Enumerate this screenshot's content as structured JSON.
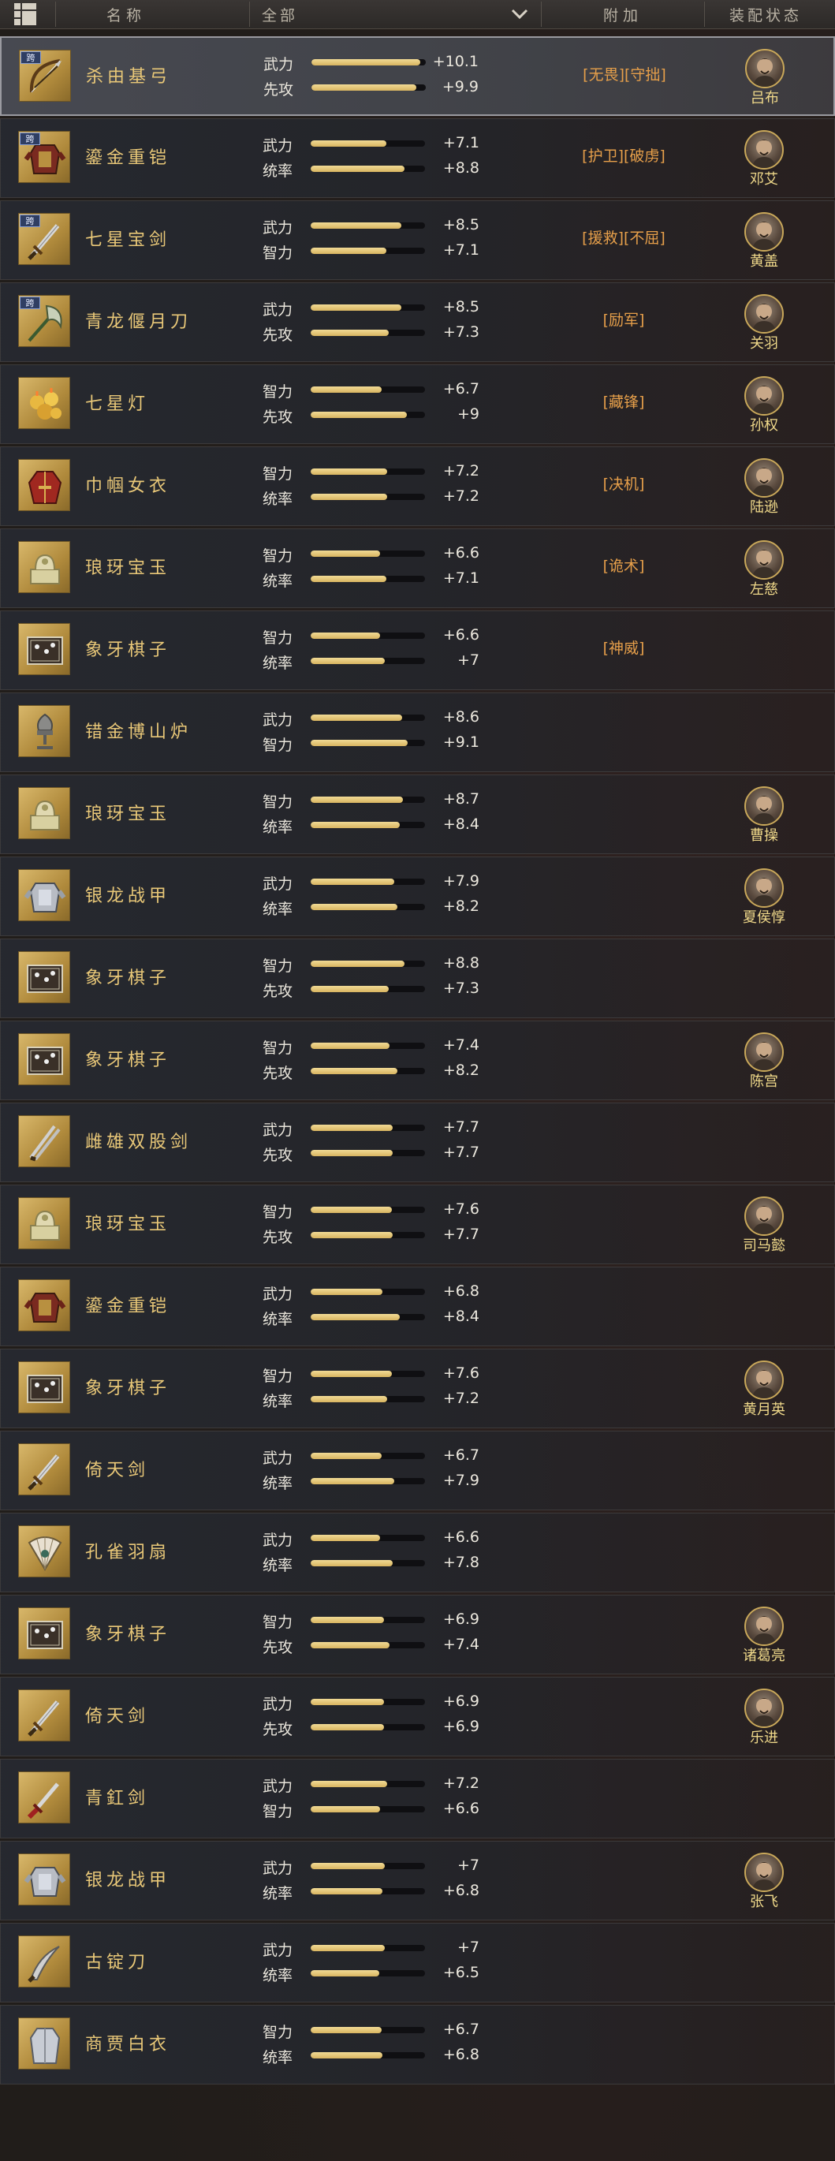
{
  "header": {
    "name_label": "名称",
    "filter_label": "全部",
    "bonus_label": "附加",
    "equip_label": "装配状态"
  },
  "items": [
    {
      "name": "杀由基弓",
      "kua": "跨",
      "icon": "bow-icon",
      "s1": "武力",
      "v1": "+10.1",
      "f1": 0.95,
      "s2": "先攻",
      "v2": "+9.9",
      "f2": 0.92,
      "tags": "[无畏][守拙]",
      "hero": "吕布",
      "selected": true
    },
    {
      "name": "鎏金重铠",
      "kua": "跨",
      "icon": "armor-icon",
      "s1": "武力",
      "v1": "+7.1",
      "f1": 0.66,
      "s2": "统率",
      "v2": "+8.8",
      "f2": 0.82,
      "tags": "[护卫][破虏]",
      "hero": "邓艾"
    },
    {
      "name": "七星宝剑",
      "kua": "跨",
      "icon": "sword-icon",
      "s1": "武力",
      "v1": "+8.5",
      "f1": 0.79,
      "s2": "智力",
      "v2": "+7.1",
      "f2": 0.66,
      "tags": "[援救][不屈]",
      "hero": "黄盖"
    },
    {
      "name": "青龙偃月刀",
      "kua": "跨",
      "icon": "glaive-icon",
      "s1": "武力",
      "v1": "+8.5",
      "f1": 0.79,
      "s2": "先攻",
      "v2": "+7.3",
      "f2": 0.68,
      "tags": "[励军]",
      "hero": "关羽"
    },
    {
      "name": "七星灯",
      "icon": "lamp-icon",
      "s1": "智力",
      "v1": "+6.7",
      "f1": 0.62,
      "s2": "先攻",
      "v2": "+9",
      "f2": 0.84,
      "tags": "[藏锋]",
      "hero": "孙权"
    },
    {
      "name": "巾帼女衣",
      "icon": "robe-icon",
      "s1": "智力",
      "v1": "+7.2",
      "f1": 0.67,
      "s2": "统率",
      "v2": "+7.2",
      "f2": 0.67,
      "tags": "[决机]",
      "hero": "陆逊"
    },
    {
      "name": "琅玡宝玉",
      "icon": "jade-seal-icon",
      "s1": "智力",
      "v1": "+6.6",
      "f1": 0.61,
      "s2": "统率",
      "v2": "+7.1",
      "f2": 0.66,
      "tags": "[诡术]",
      "hero": "左慈"
    },
    {
      "name": "象牙棋子",
      "icon": "chess-icon",
      "s1": "智力",
      "v1": "+6.6",
      "f1": 0.61,
      "s2": "统率",
      "v2": "+7",
      "f2": 0.65,
      "tags": "[神威]",
      "hero": ""
    },
    {
      "name": "错金博山炉",
      "icon": "censer-icon",
      "s1": "武力",
      "v1": "+8.6",
      "f1": 0.8,
      "s2": "智力",
      "v2": "+9.1",
      "f2": 0.85,
      "tags": "",
      "hero": ""
    },
    {
      "name": "琅玡宝玉",
      "icon": "jade-seal-icon",
      "s1": "智力",
      "v1": "+8.7",
      "f1": 0.81,
      "s2": "统率",
      "v2": "+8.4",
      "f2": 0.78,
      "tags": "",
      "hero": "曹操"
    },
    {
      "name": "银龙战甲",
      "icon": "silver-armor-icon",
      "s1": "武力",
      "v1": "+7.9",
      "f1": 0.73,
      "s2": "统率",
      "v2": "+8.2",
      "f2": 0.76,
      "tags": "",
      "hero": "夏侯惇"
    },
    {
      "name": "象牙棋子",
      "icon": "chess-icon",
      "s1": "智力",
      "v1": "+8.8",
      "f1": 0.82,
      "s2": "先攻",
      "v2": "+7.3",
      "f2": 0.68,
      "tags": "",
      "hero": ""
    },
    {
      "name": "象牙棋子",
      "icon": "chess-icon",
      "s1": "智力",
      "v1": "+7.4",
      "f1": 0.69,
      "s2": "先攻",
      "v2": "+8.2",
      "f2": 0.76,
      "tags": "",
      "hero": "陈宫"
    },
    {
      "name": "雌雄双股剑",
      "icon": "twin-swords-icon",
      "s1": "武力",
      "v1": "+7.7",
      "f1": 0.72,
      "s2": "先攻",
      "v2": "+7.7",
      "f2": 0.72,
      "tags": "",
      "hero": ""
    },
    {
      "name": "琅玡宝玉",
      "icon": "jade-seal-icon",
      "s1": "智力",
      "v1": "+7.6",
      "f1": 0.71,
      "s2": "先攻",
      "v2": "+7.7",
      "f2": 0.72,
      "tags": "",
      "hero": "司马懿"
    },
    {
      "name": "鎏金重铠",
      "icon": "armor-icon",
      "s1": "武力",
      "v1": "+6.8",
      "f1": 0.63,
      "s2": "统率",
      "v2": "+8.4",
      "f2": 0.78,
      "tags": "",
      "hero": ""
    },
    {
      "name": "象牙棋子",
      "icon": "chess-icon",
      "s1": "智力",
      "v1": "+7.6",
      "f1": 0.71,
      "s2": "统率",
      "v2": "+7.2",
      "f2": 0.67,
      "tags": "",
      "hero": "黄月英"
    },
    {
      "name": "倚天剑",
      "icon": "sword-icon",
      "s1": "武力",
      "v1": "+6.7",
      "f1": 0.62,
      "s2": "统率",
      "v2": "+7.9",
      "f2": 0.73,
      "tags": "",
      "hero": ""
    },
    {
      "name": "孔雀羽扇",
      "icon": "fan-icon",
      "s1": "武力",
      "v1": "+6.6",
      "f1": 0.61,
      "s2": "统率",
      "v2": "+7.8",
      "f2": 0.72,
      "tags": "",
      "hero": ""
    },
    {
      "name": "象牙棋子",
      "icon": "chess-icon",
      "s1": "智力",
      "v1": "+6.9",
      "f1": 0.64,
      "s2": "先攻",
      "v2": "+7.4",
      "f2": 0.69,
      "tags": "",
      "hero": "诸葛亮"
    },
    {
      "name": "倚天剑",
      "icon": "sword-icon",
      "s1": "武力",
      "v1": "+6.9",
      "f1": 0.64,
      "s2": "先攻",
      "v2": "+6.9",
      "f2": 0.64,
      "tags": "",
      "hero": "乐进"
    },
    {
      "name": "青釭剑",
      "icon": "red-sword-icon",
      "s1": "武力",
      "v1": "+7.2",
      "f1": 0.67,
      "s2": "智力",
      "v2": "+6.6",
      "f2": 0.61,
      "tags": "",
      "hero": ""
    },
    {
      "name": "银龙战甲",
      "icon": "silver-armor-icon",
      "s1": "武力",
      "v1": "+7",
      "f1": 0.65,
      "s2": "统率",
      "v2": "+6.8",
      "f2": 0.63,
      "tags": "",
      "hero": "张飞"
    },
    {
      "name": "古锭刀",
      "icon": "sabre-icon",
      "s1": "武力",
      "v1": "+7",
      "f1": 0.65,
      "s2": "统率",
      "v2": "+6.5",
      "f2": 0.6,
      "tags": "",
      "hero": ""
    },
    {
      "name": "商贾白衣",
      "icon": "white-robe-icon",
      "s1": "智力",
      "v1": "+6.7",
      "f1": 0.62,
      "s2": "统率",
      "v2": "+6.8",
      "f2": 0.63,
      "tags": "",
      "hero": ""
    }
  ]
}
